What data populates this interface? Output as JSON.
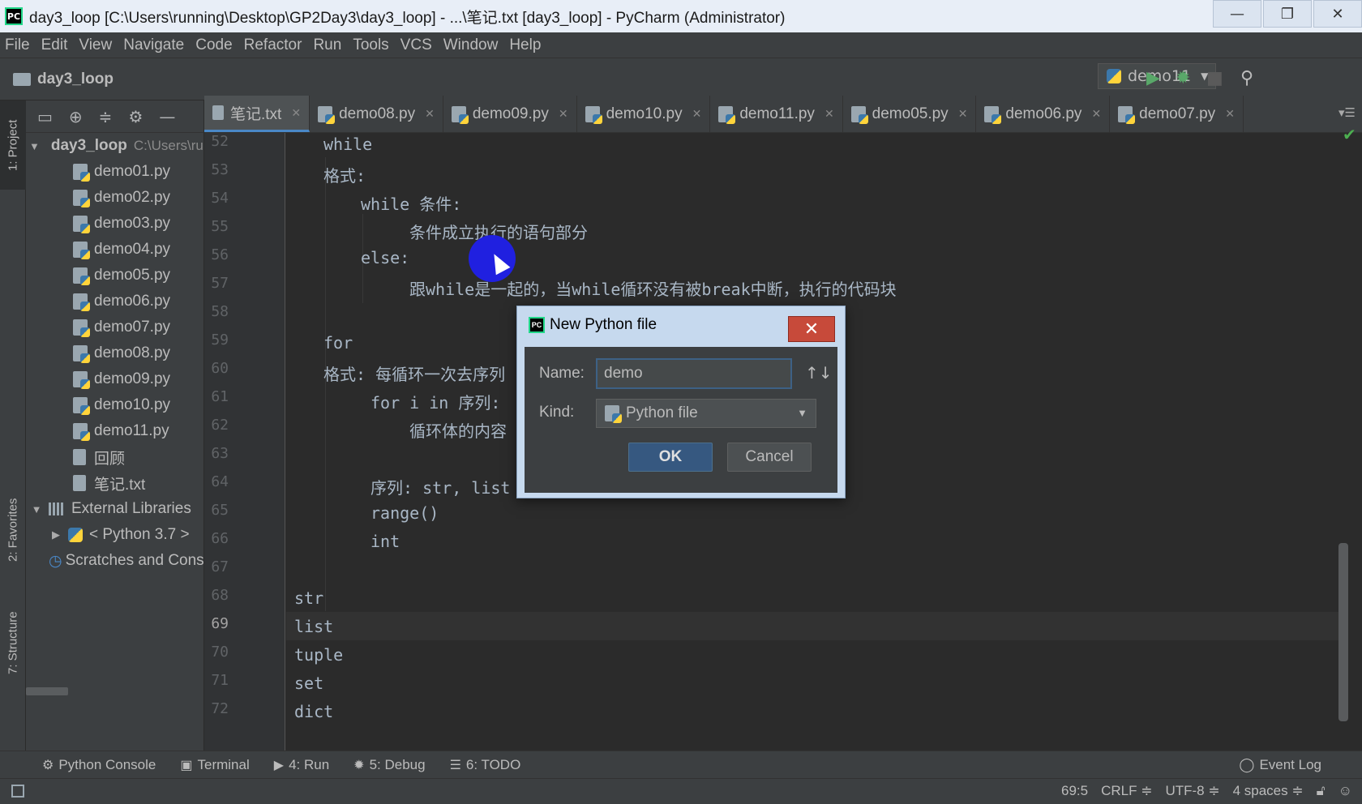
{
  "window": {
    "title": "day3_loop [C:\\Users\\running\\Desktop\\GP2Day3\\day3_loop] - ...\\笔记.txt [day3_loop] - PyCharm (Administrator)",
    "logo": "PC",
    "minimize": "—",
    "restore": "❐",
    "close": "✕"
  },
  "menu": [
    "File",
    "Edit",
    "View",
    "Navigate",
    "Code",
    "Refactor",
    "Run",
    "Tools",
    "VCS",
    "Window",
    "Help"
  ],
  "navbar": {
    "project": "day3_loop",
    "run_config": "demo11",
    "run_icon": "▶",
    "debug_icon": "✹",
    "stop_icon": "■",
    "search_icon": "⚲"
  },
  "side_tabs": {
    "project": "1: Project",
    "favorites": "2: Favorites",
    "structure": "7: Structure"
  },
  "project_tree": {
    "root": "day3_loop",
    "root_path": "C:\\Users\\running\\",
    "files": [
      "demo01.py",
      "demo02.py",
      "demo03.py",
      "demo04.py",
      "demo05.py",
      "demo06.py",
      "demo07.py",
      "demo08.py",
      "demo09.py",
      "demo10.py",
      "demo11.py"
    ],
    "txt_files": [
      "回顾",
      "笔记.txt"
    ],
    "external_libraries": "External Libraries",
    "python_sdk": "< Python 3.7 >",
    "scratches": "Scratches and Consoles"
  },
  "editor_tabs": [
    "笔记.txt",
    "demo08.py",
    "demo09.py",
    "demo10.py",
    "demo11.py",
    "demo05.py",
    "demo06.py",
    "demo07.py"
  ],
  "active_tab": 0,
  "code": {
    "lines": [
      {
        "num": "52",
        "text": "while"
      },
      {
        "num": "53",
        "text": "格式:"
      },
      {
        "num": "54",
        "text": "while 条件:"
      },
      {
        "num": "55",
        "text": "条件成立执行的语句部分"
      },
      {
        "num": "56",
        "text": "else:"
      },
      {
        "num": "57",
        "text": "跟while是一起的，当while循环没有被break中断，执行的代码块"
      },
      {
        "num": "58",
        "text": ""
      },
      {
        "num": "59",
        "text": "for"
      },
      {
        "num": "60",
        "text": "格式: 每循环一次去序列"
      },
      {
        "num": "61",
        "text": "for i in 序列:"
      },
      {
        "num": "62",
        "text": "循环体的内容"
      },
      {
        "num": "63",
        "text": ""
      },
      {
        "num": "64",
        "text": "序列: str, list"
      },
      {
        "num": "65",
        "text": "range()"
      },
      {
        "num": "66",
        "text": "int"
      },
      {
        "num": "67",
        "text": ""
      },
      {
        "num": "68",
        "text": "str"
      },
      {
        "num": "69",
        "text": "list"
      },
      {
        "num": "70",
        "text": "tuple"
      },
      {
        "num": "71",
        "text": "set"
      },
      {
        "num": "72",
        "text": "dict"
      }
    ],
    "current_line": "69"
  },
  "dialog": {
    "title": "New Python file",
    "close_label": "✕",
    "name_label": "Name:",
    "name_value": "demo",
    "sort_icon": "↑↓",
    "kind_label": "Kind:",
    "kind_value": "Python file",
    "ok_label": "OK",
    "cancel_label": "Cancel"
  },
  "bottom_tools": [
    {
      "icon": "python-console-icon",
      "glyph": "⚙",
      "label": "Python Console"
    },
    {
      "icon": "terminal-icon",
      "glyph": "▣",
      "label": "Terminal"
    },
    {
      "icon": "run-icon",
      "glyph": "▶",
      "label": "4: Run"
    },
    {
      "icon": "debug-icon",
      "glyph": "✹",
      "label": "5: Debug"
    },
    {
      "icon": "todo-icon",
      "glyph": "☰",
      "label": "6: TODO"
    }
  ],
  "event_log": "Event Log",
  "status": {
    "position": "69:5",
    "line_sep": "CRLF ≑",
    "encoding": "UTF-8 ≑",
    "indent": "4 spaces ≑"
  },
  "colors": {
    "accent": "#4a88c7",
    "ok_button": "#365880",
    "close_button": "#c74a3a",
    "cursor_highlight": "#2020e0"
  }
}
